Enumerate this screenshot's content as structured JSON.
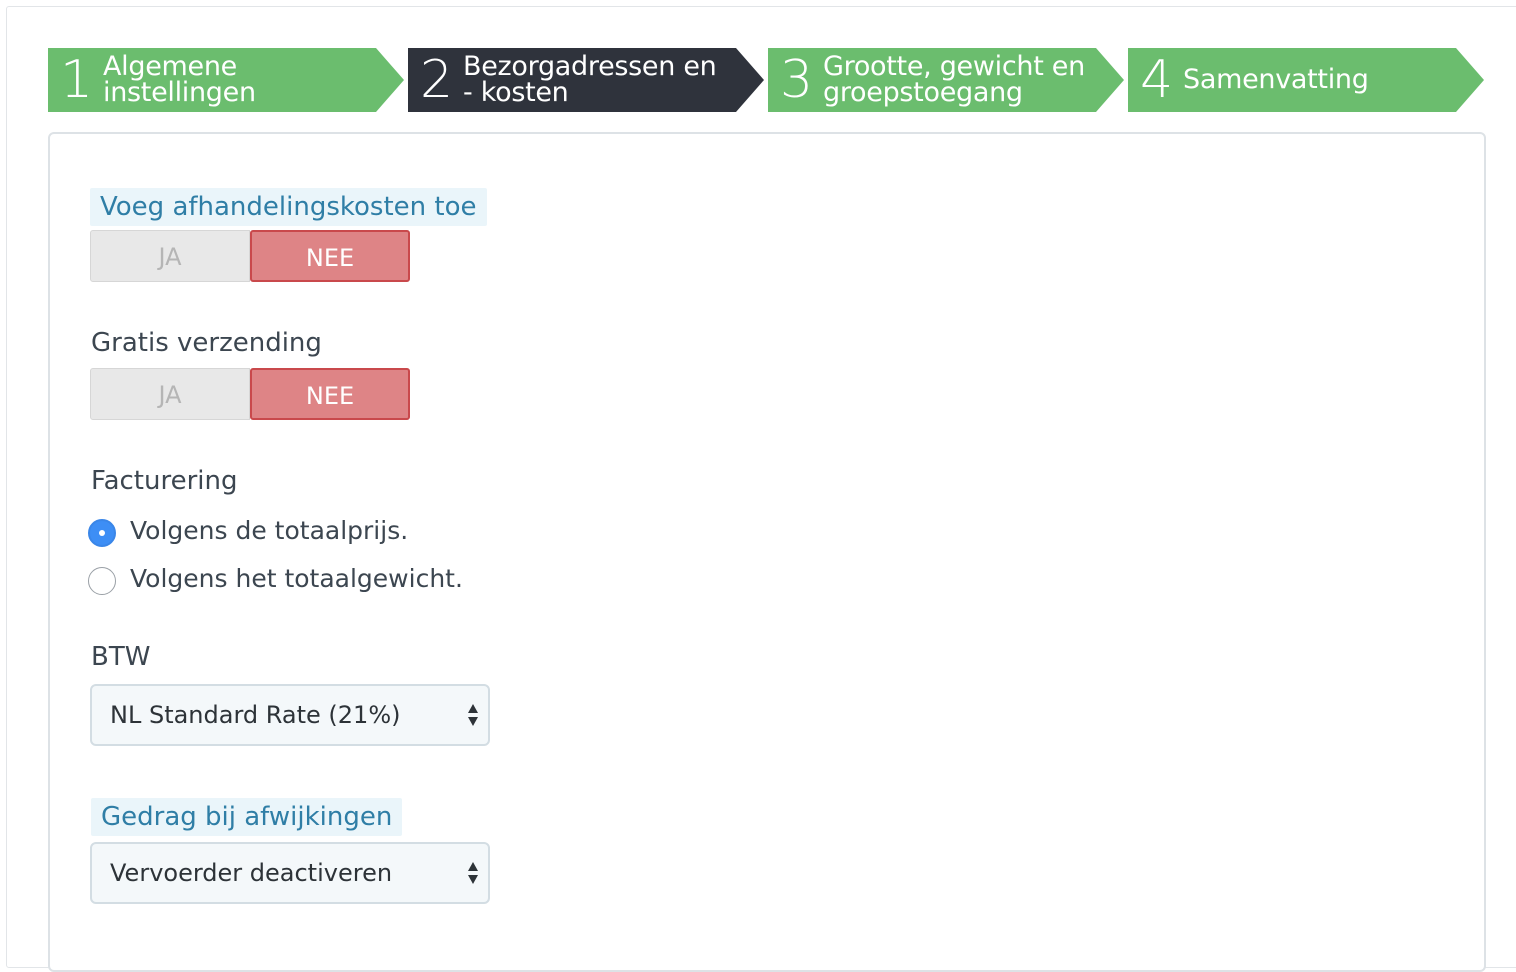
{
  "wizard": {
    "steps": [
      {
        "number": "1",
        "label": "Algemene instellingen",
        "active": false
      },
      {
        "number": "2",
        "label": "Bezorgadressen en - kosten",
        "active": true
      },
      {
        "number": "3",
        "label": "Grootte, gewicht en groepstoegang",
        "active": false
      },
      {
        "number": "4",
        "label": "Samenvatting",
        "active": false
      }
    ]
  },
  "form": {
    "handling_fees": {
      "label": "Voeg afhandelingskosten toe",
      "yes": "JA",
      "no": "NEE",
      "selected": "NEE"
    },
    "free_shipping": {
      "label": "Gratis verzending",
      "yes": "JA",
      "no": "NEE",
      "selected": "NEE"
    },
    "billing": {
      "label": "Facturering",
      "options": [
        {
          "label": "Volgens de totaalprijs.",
          "checked": true
        },
        {
          "label": "Volgens het totaalgewicht.",
          "checked": false
        }
      ]
    },
    "tax": {
      "label": "BTW",
      "value": "NL Standard Rate (21%)"
    },
    "out_of_range": {
      "label": "Gedrag bij afwijkingen",
      "value": "Vervoerder deactiveren"
    }
  },
  "colors": {
    "step_green": "#6bbd6e",
    "step_active": "#2f333c",
    "switch_no_active": "#de8486",
    "radio_checked": "#3d8ef5",
    "label_highlight": "#2f7ea6"
  },
  "icons": {
    "select_arrows": "updown-arrows-icon"
  }
}
